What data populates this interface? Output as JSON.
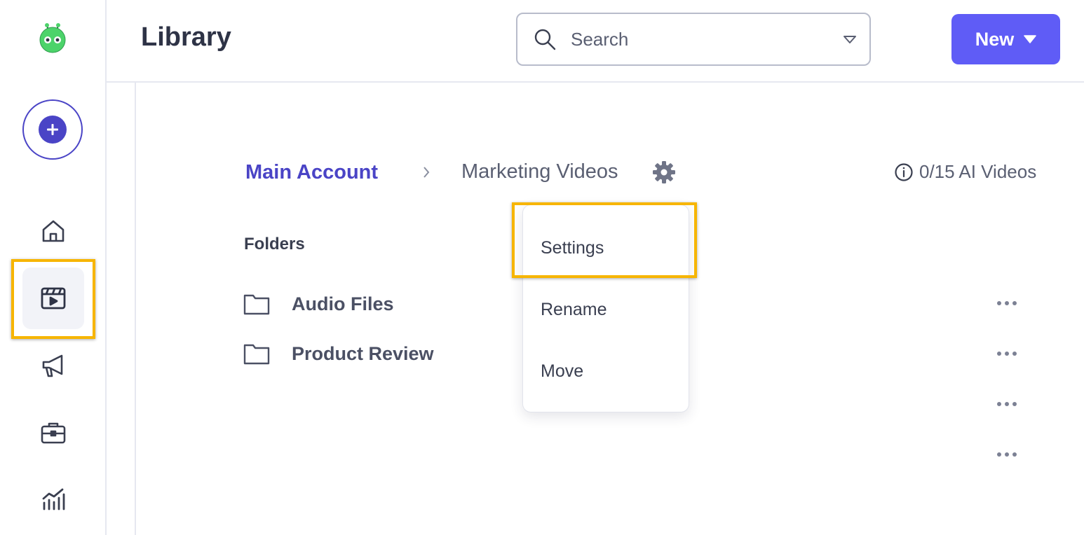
{
  "sidebar": {
    "logo_icon": "robot-logo",
    "create_icon": "plus-icon",
    "nav": [
      {
        "name": "home",
        "icon": "home-icon"
      },
      {
        "name": "library",
        "icon": "video-clapper-icon",
        "active": true
      },
      {
        "name": "campaigns",
        "icon": "megaphone-icon"
      },
      {
        "name": "portfolio",
        "icon": "briefcase-icon"
      },
      {
        "name": "analytics",
        "icon": "bar-chart-icon"
      }
    ]
  },
  "header": {
    "title": "Library",
    "search": {
      "placeholder": "Search",
      "value": ""
    },
    "new_label": "New"
  },
  "breadcrumb": {
    "root": "Main Account",
    "current": "Marketing Videos"
  },
  "ai_videos": "0/15 AI Videos",
  "folders": {
    "label": "Folders",
    "items": [
      {
        "name": "Audio Files"
      },
      {
        "name": "Product Review"
      }
    ]
  },
  "menu": {
    "items": [
      "Settings",
      "Rename",
      "Move"
    ]
  },
  "colors": {
    "accent": "#4a44c6",
    "primary_button": "#5f5cf6",
    "highlight": "#f7b500",
    "text": "#3a3f50",
    "muted": "#5a5f72"
  }
}
